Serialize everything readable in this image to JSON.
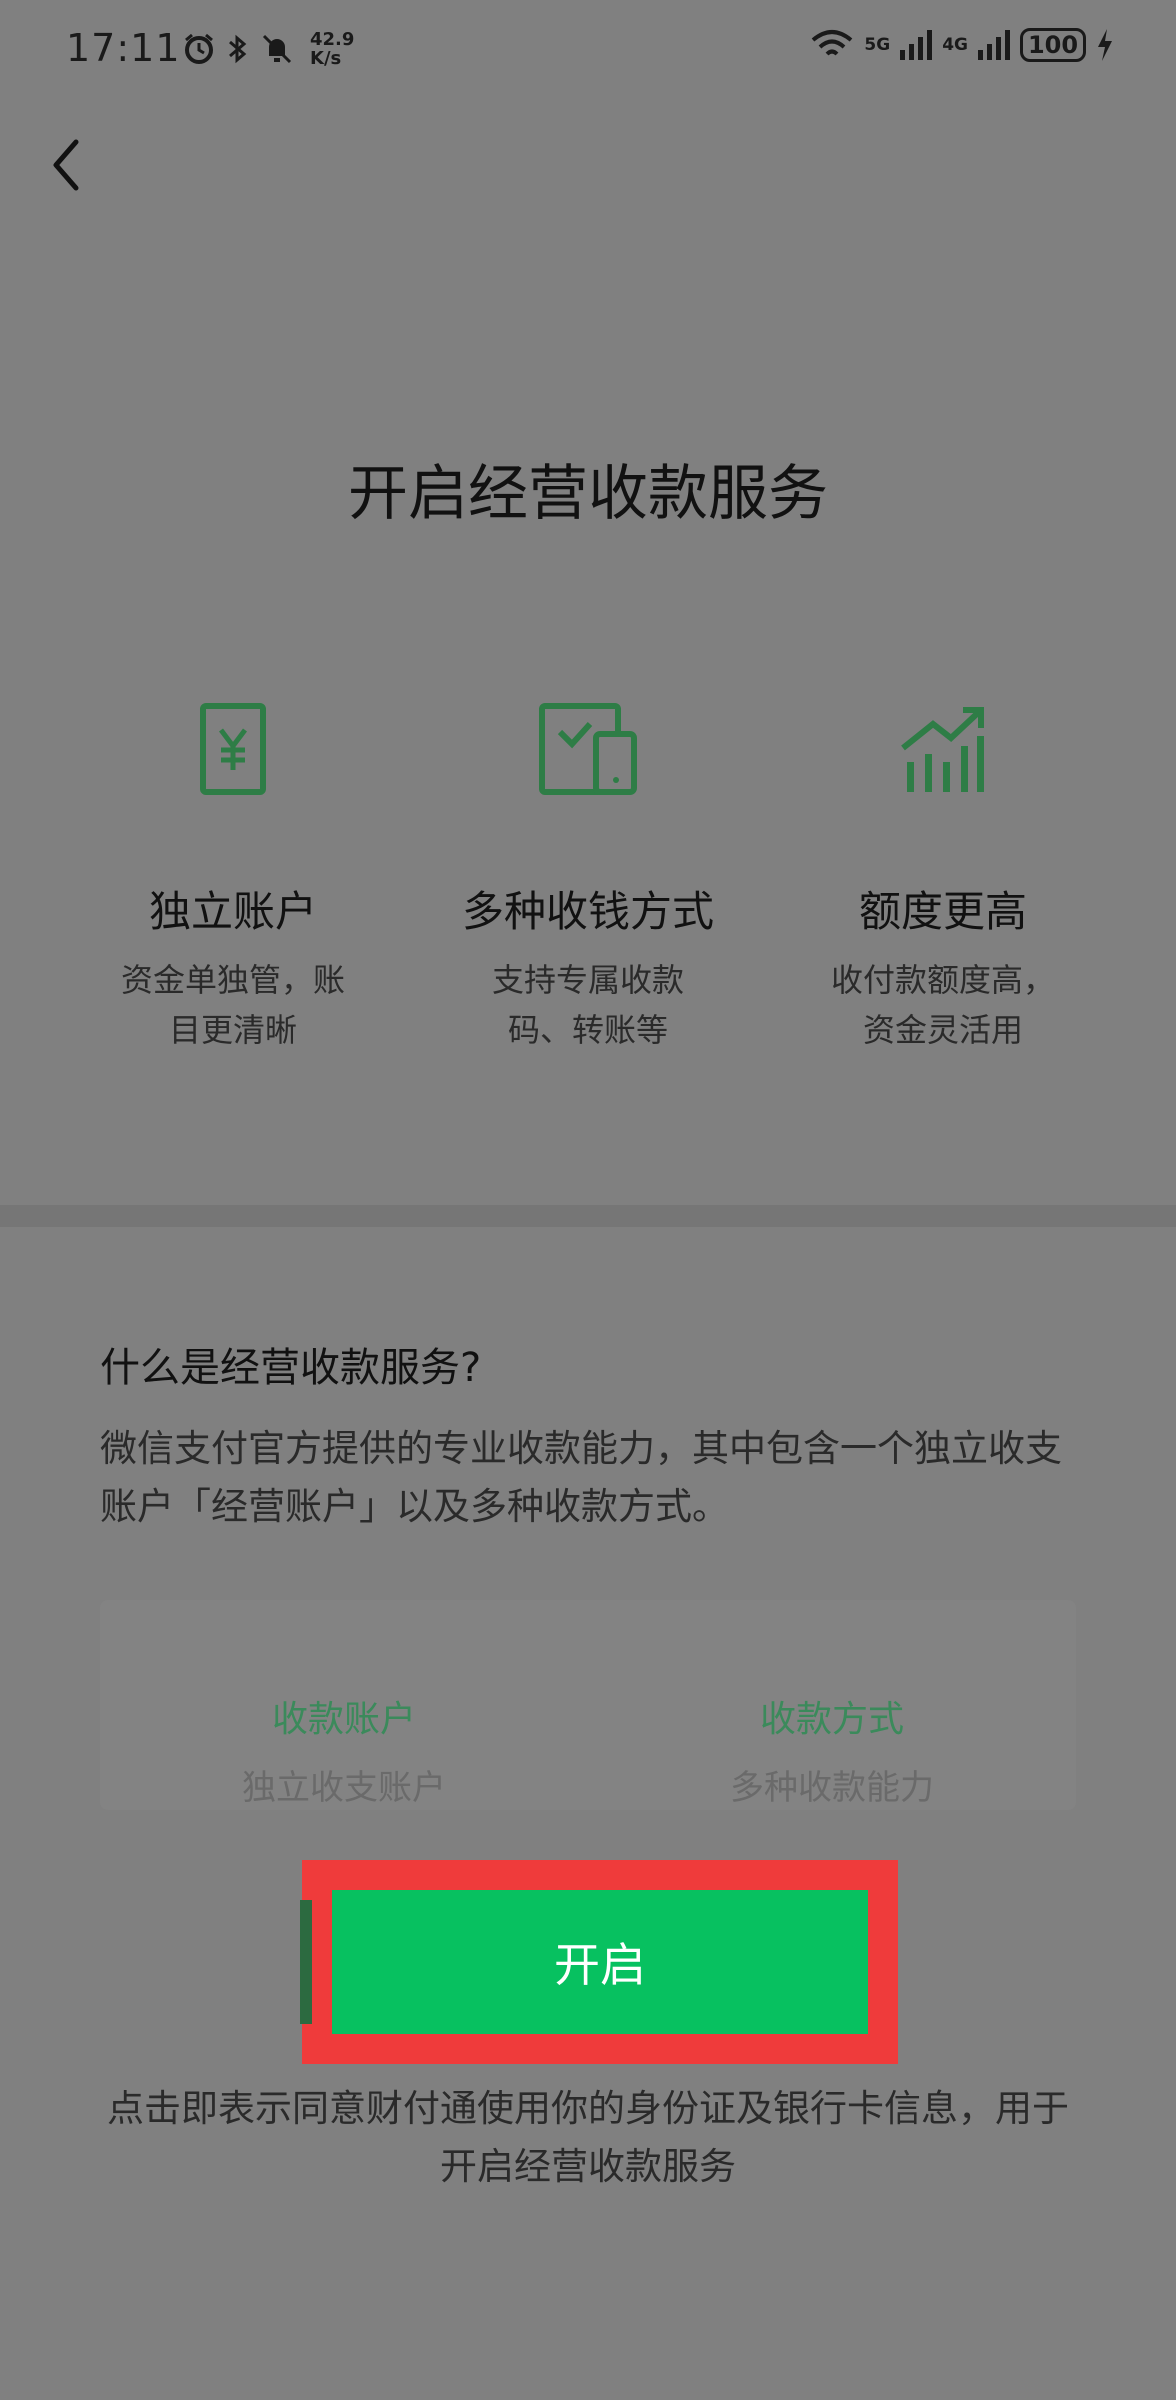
{
  "status_bar": {
    "time": "17:11",
    "speed_value": "42.9",
    "speed_unit": "K/s",
    "signal_1_label": "5G",
    "signal_2_label": "4G",
    "battery": "100"
  },
  "title": "开启经营收款服务",
  "features": [
    {
      "icon": "yuan-receipt-icon",
      "title": "独立账户",
      "desc": "资金单独管，账目更清晰"
    },
    {
      "icon": "devices-check-icon",
      "title": "多种收钱方式",
      "desc": "支持专属收款码、转账等"
    },
    {
      "icon": "bar-chart-up-icon",
      "title": "额度更高",
      "desc": "收付款额度高，资金灵活用"
    }
  ],
  "info": {
    "question": "什么是经营收款服务?",
    "description": "微信支付官方提供的专业收款能力，其中包含一个独立收支账户「经营账户」以及多种收款方式。"
  },
  "table": {
    "col1_header": "收款账户",
    "col1_value": "独立收支账户",
    "col2_header": "收款方式",
    "col2_value": "多种收款能力"
  },
  "button": {
    "label": "开启"
  },
  "agreement": "点击即表示同意财付通使用你的身份证及银行卡信息，用于开启经营收款服务",
  "colors": {
    "accent": "#07c160",
    "highlight": "#ef3b3b",
    "overlay": "#808080"
  }
}
